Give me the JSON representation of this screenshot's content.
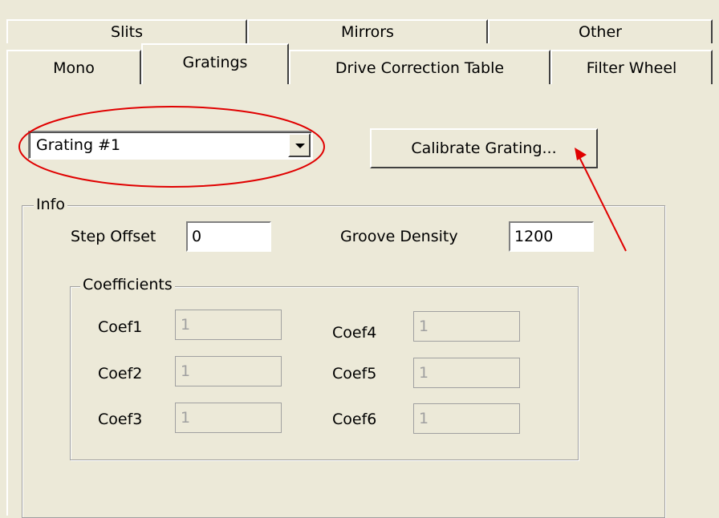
{
  "tabs_row1": [
    "Slits",
    "Mirrors",
    "Other"
  ],
  "tabs_row2": [
    "Mono",
    "Gratings",
    "Drive Correction Table",
    "Filter Wheel"
  ],
  "grating_select": {
    "value": "Grating #1"
  },
  "calibrate_button": "Calibrate Grating...",
  "info": {
    "legend": "Info",
    "step_offset_label": "Step Offset",
    "step_offset_value": "0",
    "groove_density_label": "Groove Density",
    "groove_density_value": "1200"
  },
  "coefficients": {
    "legend": "Coefficients",
    "labels": [
      "Coef1",
      "Coef2",
      "Coef3",
      "Coef4",
      "Coef5",
      "Coef6"
    ],
    "values": [
      "1",
      "1",
      "1",
      "1",
      "1",
      "1"
    ]
  },
  "annotation_color": "#e00000"
}
